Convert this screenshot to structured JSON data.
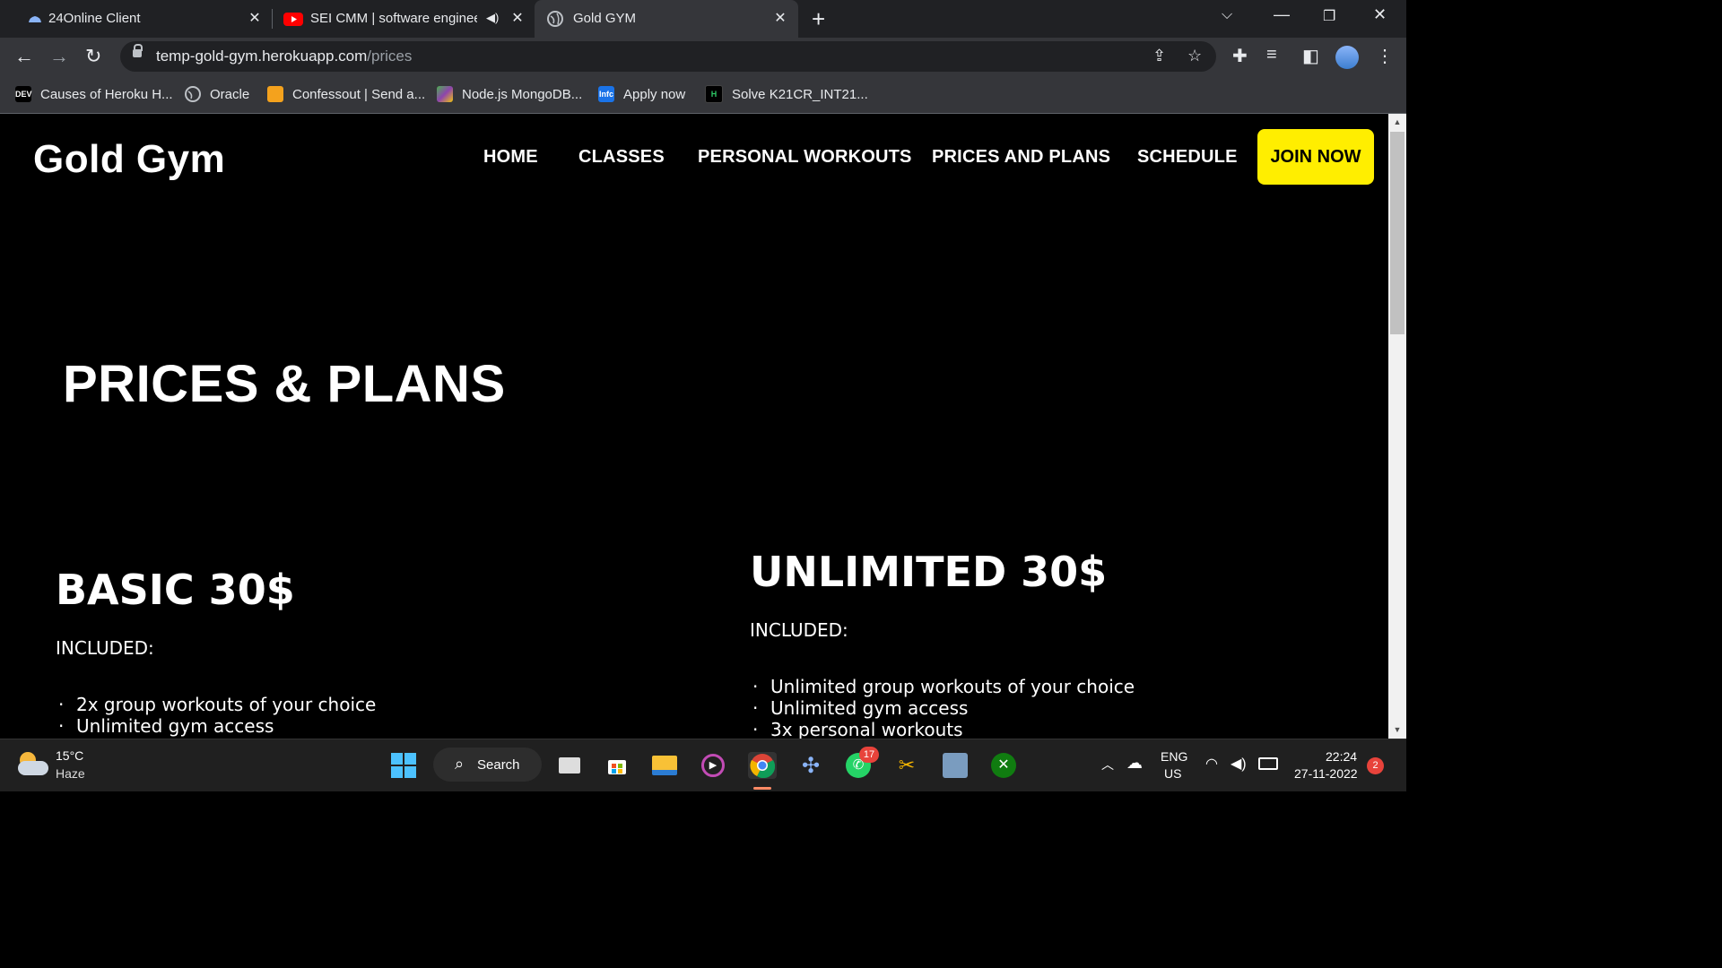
{
  "browser": {
    "tabs": [
      {
        "title": "24Online Client",
        "favicon": "cloud-icon"
      },
      {
        "title": "SEI CMM | software engineer",
        "favicon": "youtube-icon",
        "audio": true
      },
      {
        "title": "Gold GYM",
        "favicon": "globe-icon",
        "active": true
      }
    ],
    "url_host": "temp-gold-gym.herokuapp.com",
    "url_path": "/prices",
    "bookmarks": [
      {
        "label": "Causes of Heroku H...",
        "icon": "DEV"
      },
      {
        "label": "Oracle",
        "icon": "globe-icon"
      },
      {
        "label": "Confessout | Send a...",
        "icon": "confessout-icon"
      },
      {
        "label": "Node.js MongoDB...",
        "icon": "mongodb-icon"
      },
      {
        "label": "Apply now",
        "icon": "Infc"
      },
      {
        "label": "Solve K21CR_INT21...",
        "icon": "H"
      }
    ]
  },
  "site": {
    "brand": "Gold Gym",
    "nav": [
      "HOME",
      "CLASSES",
      "PERSONAL WORKOUTS",
      "PRICES AND PLANS",
      "SCHEDULE"
    ],
    "cta": "JOIN NOW",
    "accent_color": "#ffee00"
  },
  "page": {
    "title": "PRICES & PLANS",
    "plans": [
      {
        "name": "BASIC 30$",
        "included_label": "INCLUDED:",
        "features": [
          "2x group workouts of your choice",
          "Unlimited gym access"
        ]
      },
      {
        "name": "UNLIMITED 30$",
        "included_label": "INCLUDED:",
        "features": [
          "Unlimited group workouts of your choice",
          "Unlimited gym access",
          "3x personal workouts"
        ]
      }
    ]
  },
  "taskbar": {
    "weather_temp": "15°C",
    "weather_desc": "Haze",
    "search_label": "Search",
    "whatsapp_badge": "17",
    "lang_top": "ENG",
    "lang_bottom": "US",
    "time": "22:24",
    "date": "27-11-2022",
    "notification_count": "2"
  }
}
